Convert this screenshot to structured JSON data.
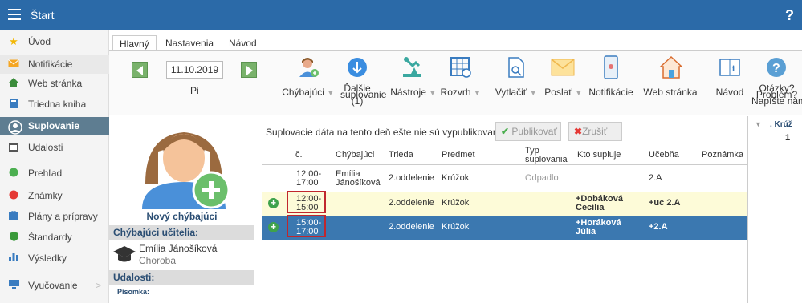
{
  "topbar": {
    "title": "Štart",
    "help": "?"
  },
  "sidebar": {
    "items": [
      {
        "label": "Úvod",
        "icon": "star-icon"
      },
      {
        "label": "Notifikácie",
        "icon": "mail-icon"
      },
      {
        "label": "Web stránka",
        "icon": "home-icon"
      },
      {
        "label": "Triedna kniha",
        "icon": "book-icon"
      },
      {
        "label": "Suplovanie",
        "icon": "person-icon",
        "active": true
      },
      {
        "label": "Udalosti",
        "icon": "calendar-icon"
      },
      {
        "label": "Prehľad",
        "icon": "circle-icon"
      },
      {
        "label": "Známky",
        "icon": "grade-icon"
      },
      {
        "label": "Plány a prípravy",
        "icon": "briefcase-icon"
      },
      {
        "label": "Štandardy",
        "icon": "shield-icon"
      },
      {
        "label": "Výsledky",
        "icon": "bar-chart-icon"
      },
      {
        "label": "Vyučovanie",
        "icon": "monitor-icon",
        "chevron": ">"
      }
    ]
  },
  "tabs": [
    "Hlavný",
    "Nastavenia",
    "Návod"
  ],
  "ribbon": {
    "date": "11.10.2019",
    "day": "Pi",
    "absent": "Chýbajúci",
    "next_line1": "Ďalšie",
    "next_line2": "suplovanie",
    "next_line3": "(1)",
    "tools": "Nástroje",
    "schedule": "Rozvrh",
    "print": "Vytlačiť",
    "send": "Poslať",
    "notifications": "Notifikácie",
    "web": "Web stránka",
    "guide": "Návod",
    "help_line1": "Otázky?",
    "help_line2": "Problém?",
    "help_line3": "Napíšte nám."
  },
  "leftpanel": {
    "new_absent": "Nový chýbajúci",
    "absent_teachers_hdr": "Chýbajúci učitelia:",
    "teacher_name": "Emília Jánošíková",
    "teacher_reason": "Choroba",
    "events_hdr": "Udalosti:",
    "event_item": "Písomka:"
  },
  "main": {
    "notice": "Suplovacie dáta na tento deň ešte nie sú vypublikované.",
    "publish_label": "Publikovať",
    "cancel_label": "Zrušiť",
    "headers": {
      "num": "č.",
      "absent": "Chýbajúci",
      "class": "Trieda",
      "subject": "Predmet",
      "type_line1": "Typ",
      "type_line2": "suplovania",
      "who": "Kto supluje",
      "room": "Učebňa",
      "note": "Poznámka"
    },
    "rows": [
      {
        "time1": "12:00-",
        "time2": "17:00",
        "absent1": "Emília",
        "absent2": "Jánošíková",
        "class": "2.oddelenie",
        "subject": "Krúžok",
        "type": "Odpadlo",
        "who1": "",
        "who2": "",
        "room": "2.A"
      },
      {
        "time1": "12:00-",
        "time2": "15:00",
        "absent1": "",
        "absent2": "",
        "class": "2.oddelenie",
        "subject": "Krúžok",
        "type": "",
        "who1": "+Dobáková",
        "who2": "Cecília",
        "room": "+uc 2.A"
      },
      {
        "time1": "15:00-",
        "time2": "17:00",
        "absent1": "",
        "absent2": "",
        "class": "2.oddelenie",
        "subject": "Krúžok",
        "type": "",
        "who1": "+Horáková",
        "who2": "Júlia",
        "room": "+2.A"
      }
    ]
  },
  "rightpanel": {
    "title": ". Krúž",
    "value": "1"
  },
  "colors": {
    "topbar": "#2b6aa8",
    "active_side": "#5e7d91",
    "selected_row": "#3b78b0",
    "highlight_row": "#fdfbd8",
    "accent_red": "#c0272d",
    "green": "#3fa24b"
  }
}
